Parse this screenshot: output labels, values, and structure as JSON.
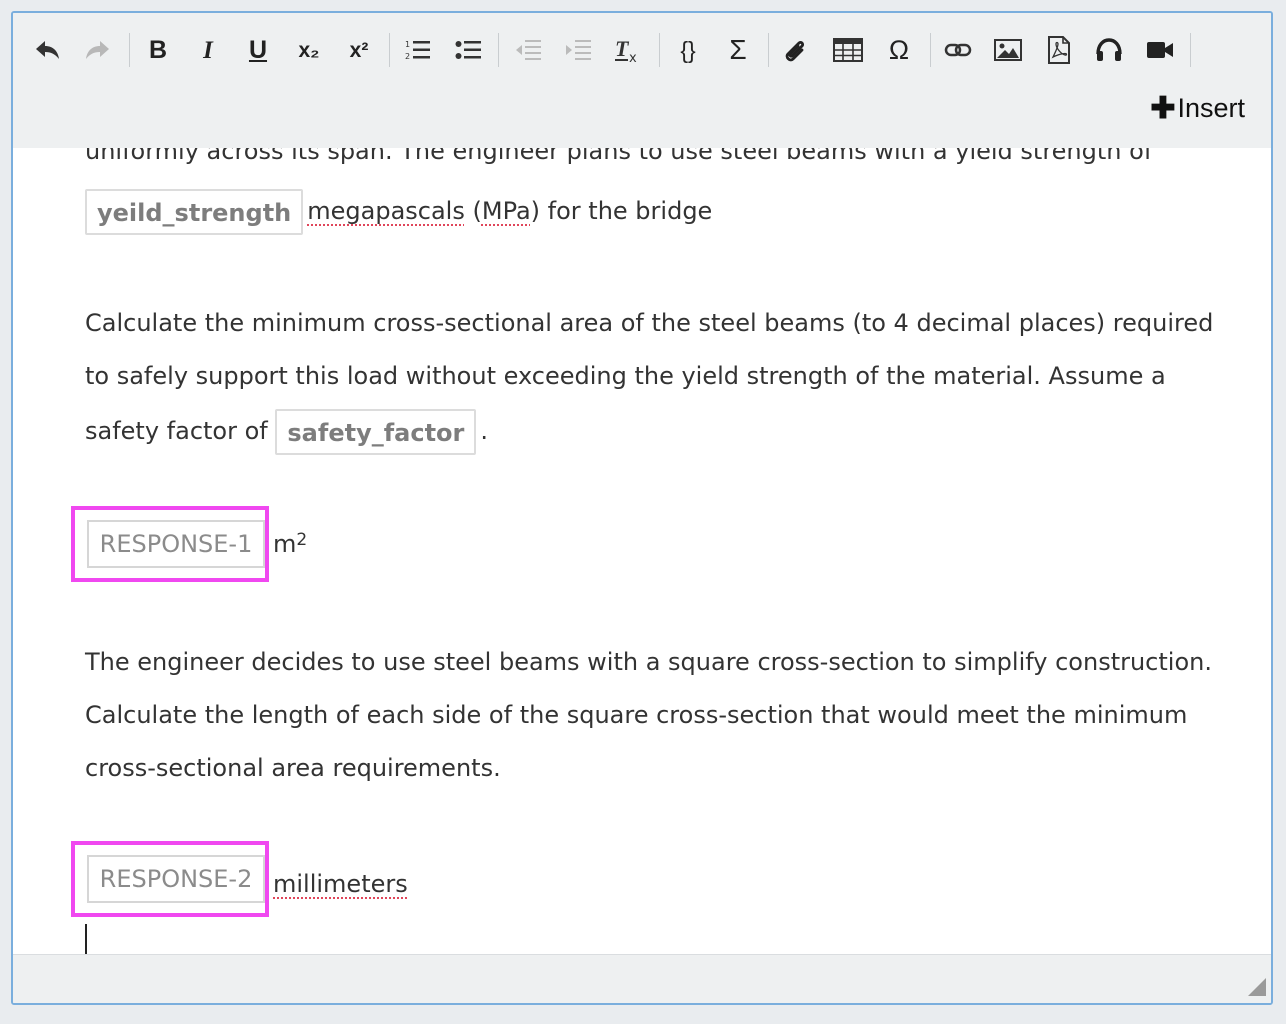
{
  "toolbar": {
    "buttons": [
      {
        "name": "undo",
        "label": ""
      },
      {
        "name": "redo",
        "label": ""
      },
      {
        "name": "bold",
        "label": "B"
      },
      {
        "name": "italic",
        "label": "I"
      },
      {
        "name": "underline",
        "label": "U"
      },
      {
        "name": "subscript",
        "label": "x₂"
      },
      {
        "name": "superscript",
        "label": "x²"
      },
      {
        "name": "numbered-list",
        "label": ""
      },
      {
        "name": "bulleted-list",
        "label": ""
      },
      {
        "name": "outdent",
        "label": ""
      },
      {
        "name": "indent",
        "label": ""
      },
      {
        "name": "clear-format",
        "label": ""
      },
      {
        "name": "code-braces",
        "label": "{}"
      },
      {
        "name": "math-sigma",
        "label": "Σ"
      },
      {
        "name": "attachment",
        "label": ""
      },
      {
        "name": "table",
        "label": ""
      },
      {
        "name": "special-char",
        "label": "Ω"
      },
      {
        "name": "link",
        "label": ""
      },
      {
        "name": "image",
        "label": ""
      },
      {
        "name": "pdf",
        "label": ""
      },
      {
        "name": "audio",
        "label": ""
      },
      {
        "name": "video",
        "label": ""
      }
    ],
    "insert_label": "Insert"
  },
  "content": {
    "p1_line1": "uniformly across its span. The engineer plans to use steel beams with a yield strength of",
    "p1_var": "yeild_strength",
    "p1_word_megapascals": "megapascals",
    "p1_paren_open": " (",
    "p1_word_mpa": "MPa",
    "p1_tail": ") for the bridge",
    "p2_line1": "Calculate the minimum cross-sectional area of the steel beams (to 4 decimal places) required",
    "p2_line2": "to safely support this load without exceeding the yield strength of the material. Assume a",
    "p2_line3_prefix": "safety factor of",
    "p2_var": "safety_factor",
    "p2_line3_suffix": ".",
    "response1_label": "RESPONSE-1",
    "response1_unit": "m",
    "response1_unit_sup": "2",
    "p3_line1": "The engineer decides to use steel beams with a square cross-section to simplify construction.",
    "p3_line2": "Calculate the length of each side of the square cross-section that would meet the minimum",
    "p3_line3": "cross-sectional area requirements.",
    "response2_label": "RESPONSE-2",
    "response2_unit": "millimeters"
  }
}
